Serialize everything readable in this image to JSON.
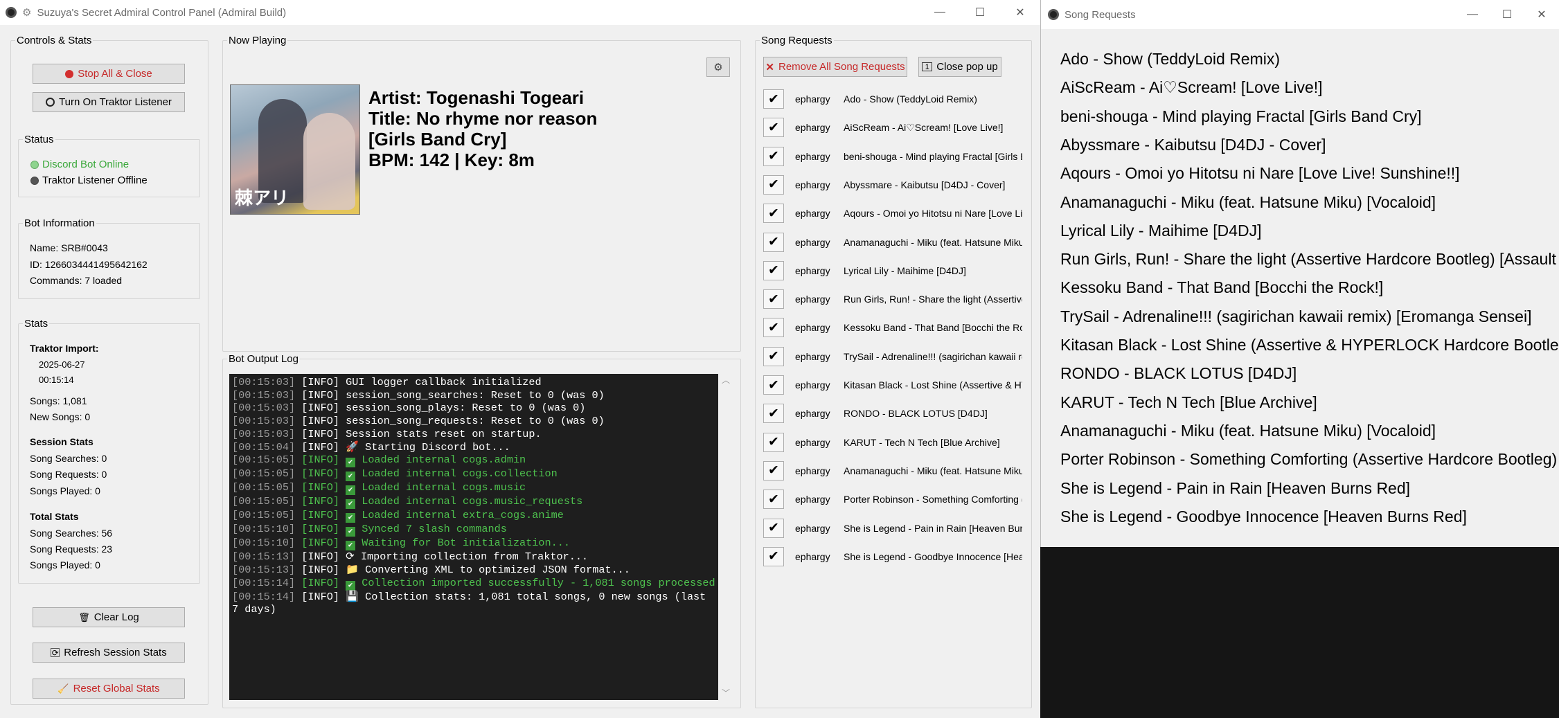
{
  "window": {
    "title": "Suzuya's Secret Admiral Control Panel (Admiral Build)"
  },
  "controls": {
    "legend": "Controls & Stats",
    "stop_btn": "Stop All & Close",
    "traktor_btn": "Turn On Traktor Listener"
  },
  "status": {
    "legend": "Status",
    "discord": "Discord Bot Online",
    "traktor": "Traktor Listener Offline",
    "discord_color": "#3aa83a"
  },
  "bot_info": {
    "legend": "Bot Information",
    "name": "Name: SRB#0043",
    "id": "ID: 1266034441495642162",
    "commands": "Commands: 7 loaded"
  },
  "stats": {
    "legend": "Stats",
    "traktor_import_label": "Traktor Import:",
    "import_date": "2025-06-27",
    "import_time": "00:15:14",
    "songs": "Songs: 1,081",
    "new_songs": "New Songs: 0",
    "session_label": "Session Stats",
    "session_searches": "Song Searches: 0",
    "session_requests": "Song Requests: 0",
    "session_played": "Songs Played: 0",
    "total_label": "Total Stats",
    "total_searches": "Song Searches: 56",
    "total_requests": "Song Requests: 23",
    "total_played": "Songs Played: 0"
  },
  "bottom_buttons": {
    "clear_log": "Clear Log",
    "refresh": "Refresh Session Stats",
    "reset": "Reset Global Stats"
  },
  "now_playing": {
    "legend": "Now Playing",
    "artist": "Artist: Togenashi Togeari",
    "title": "Title: No rhyme nor reason",
    "tag": "[Girls Band Cry]",
    "bpm_key": "BPM: 142 | Key: 8m",
    "cover_text": "棘アリ"
  },
  "log": {
    "legend": "Bot Output Log",
    "lines": [
      {
        "ts": "[00:15:03]",
        "lvl": "[INFO]",
        "icon": "",
        "msg": "GUI logger callback initialized",
        "ok": false
      },
      {
        "ts": "[00:15:03]",
        "lvl": "[INFO]",
        "icon": "",
        "msg": "session_song_searches: Reset to 0 (was 0)",
        "ok": false
      },
      {
        "ts": "[00:15:03]",
        "lvl": "[INFO]",
        "icon": "",
        "msg": "session_song_plays: Reset to 0 (was 0)",
        "ok": false
      },
      {
        "ts": "[00:15:03]",
        "lvl": "[INFO]",
        "icon": "",
        "msg": "session_song_requests: Reset to 0 (was 0)",
        "ok": false
      },
      {
        "ts": "[00:15:03]",
        "lvl": "[INFO]",
        "icon": "",
        "msg": "Session stats reset on startup.",
        "ok": false
      },
      {
        "ts": "[00:15:04]",
        "lvl": "[INFO]",
        "icon": "🚀",
        "msg": "Starting Discord bot...",
        "ok": false
      },
      {
        "ts": "[00:15:05]",
        "lvl": "[INFO]",
        "icon": "✔",
        "msg": "Loaded internal cogs.admin",
        "ok": true
      },
      {
        "ts": "[00:15:05]",
        "lvl": "[INFO]",
        "icon": "✔",
        "msg": "Loaded internal cogs.collection",
        "ok": true
      },
      {
        "ts": "[00:15:05]",
        "lvl": "[INFO]",
        "icon": "✔",
        "msg": "Loaded internal cogs.music",
        "ok": true
      },
      {
        "ts": "[00:15:05]",
        "lvl": "[INFO]",
        "icon": "✔",
        "msg": "Loaded internal cogs.music_requests",
        "ok": true
      },
      {
        "ts": "[00:15:05]",
        "lvl": "[INFO]",
        "icon": "✔",
        "msg": "Loaded internal extra_cogs.anime",
        "ok": true
      },
      {
        "ts": "[00:15:10]",
        "lvl": "[INFO]",
        "icon": "✔",
        "msg": "Synced 7 slash commands",
        "ok": true
      },
      {
        "ts": "[00:15:10]",
        "lvl": "[INFO]",
        "icon": "✔",
        "msg": "Waiting for Bot initialization...",
        "ok": true
      },
      {
        "ts": "[00:15:13]",
        "lvl": "[INFO]",
        "icon": "⟳",
        "msg": "Importing collection from Traktor...",
        "ok": false
      },
      {
        "ts": "[00:15:13]",
        "lvl": "[INFO]",
        "icon": "📁",
        "msg": "Converting XML to optimized JSON format...",
        "ok": false
      },
      {
        "ts": "[00:15:14]",
        "lvl": "[INFO]",
        "icon": "✔",
        "msg": "Collection imported successfully - 1,081 songs processed",
        "ok": true
      },
      {
        "ts": "[00:15:14]",
        "lvl": "[INFO]",
        "icon": "💾",
        "msg": "Collection stats: 1,081 total songs, 0 new songs (last 7 days)",
        "ok": false
      }
    ]
  },
  "requests": {
    "legend": "Song Requests",
    "remove_all": "Remove All Song Requests",
    "close_popup": "Close pop up",
    "user": "ephargy",
    "songs": [
      "Ado - Show (TeddyLoid Remix)",
      "AiScReam - Ai♡Scream! [Love Live!]",
      "beni-shouga - Mind playing Fractal [Girls Band Cry]",
      "Abyssmare - Kaibutsu [D4DJ - Cover]",
      "Aqours - Omoi yo Hitotsu ni Nare [Love Live! Sunshine!!]",
      "Anamanaguchi - Miku (feat. Hatsune Miku) [Vocaloid]",
      "Lyrical Lily - Maihime [D4DJ]",
      "Run Girls, Run! - Share the light (Assertive Hardcore Bootleg) [Assault Lily]",
      "Kessoku Band - That Band [Bocchi the Rock!]",
      "TrySail - Adrenaline!!! (sagirichan kawaii remix) [Eromanga Sensei]",
      "Kitasan Black - Lost Shine (Assertive & HYPERLOCK Hardcore Bootleg)",
      "RONDO - BLACK LOTUS [D4DJ]",
      "KARUT - Tech N Tech [Blue Archive]",
      "Anamanaguchi - Miku (feat. Hatsune Miku) [Vocaloid]",
      "Porter Robinson - Something Comforting (Assertive Hardcore Bootleg)",
      "She is Legend - Pain in Rain [Heaven Burns Red]",
      "She is Legend - Goodbye Innocence [Heaven Burns Red]"
    ]
  },
  "popup": {
    "title": "Song Requests"
  }
}
